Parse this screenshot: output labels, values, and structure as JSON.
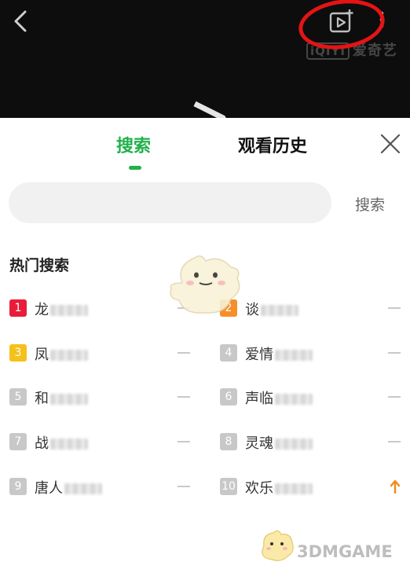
{
  "player": {
    "brand_logo": "iQIYI",
    "brand_text": "爱奇艺",
    "icons": [
      "back-chevron-icon",
      "add-video-icon",
      "more-vertical-icon",
      "play-icon"
    ],
    "highlight_color": "#e51414"
  },
  "tabs": [
    {
      "label": "搜索",
      "active": true
    },
    {
      "label": "观看历史",
      "active": false
    }
  ],
  "search": {
    "placeholder": "",
    "value": "",
    "button_label": "搜索"
  },
  "hot": {
    "title": "热门搜索",
    "items": [
      {
        "rank": "1",
        "name": "龙",
        "trend": "flat"
      },
      {
        "rank": "2",
        "name": "谈",
        "trend": "flat"
      },
      {
        "rank": "3",
        "name": "凤",
        "trend": "flat"
      },
      {
        "rank": "4",
        "name": "爱情",
        "trend": "flat"
      },
      {
        "rank": "5",
        "name": "和",
        "trend": "flat"
      },
      {
        "rank": "6",
        "name": "声临",
        "trend": "flat"
      },
      {
        "rank": "7",
        "name": "战",
        "trend": "flat"
      },
      {
        "rank": "8",
        "name": "灵魂",
        "trend": "flat"
      },
      {
        "rank": "9",
        "name": "唐人",
        "trend": "flat"
      },
      {
        "rank": "10",
        "name": "欢乐",
        "trend": "up"
      }
    ]
  },
  "colors": {
    "accent": "#22b14c",
    "rank1": "#e81d3a",
    "rank2": "#f58f2a",
    "rank3": "#f5c11b",
    "rank_other": "#c8c8c8",
    "trend_up": "#f08a1c"
  },
  "watermark": "3DMGAME"
}
